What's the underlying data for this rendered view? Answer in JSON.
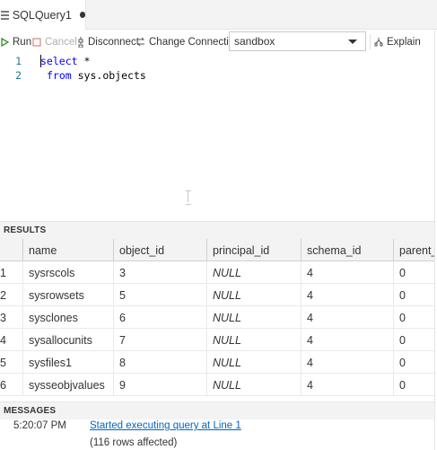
{
  "tab": {
    "title": "SQLQuery1",
    "icon": "file-lines-icon",
    "dirty_indicator": "dot"
  },
  "toolbar": {
    "run": "Run",
    "cancel": "Cancel",
    "disconnect": "Disconnect",
    "change_connection": "Change Connection",
    "database": "sandbox",
    "explain": "Explain"
  },
  "editor": {
    "lines": [
      {
        "number": "1",
        "keyword": "select",
        "rest": " *"
      },
      {
        "number": "2",
        "keyword": "from",
        "rest": " sys.objects"
      }
    ]
  },
  "results": {
    "header": "RESULTS",
    "columns": [
      "name",
      "object_id",
      "principal_id",
      "schema_id",
      "parent_"
    ],
    "rows": [
      {
        "num": "1",
        "cells": [
          "sysrscols",
          "3",
          "NULL",
          "4",
          "0"
        ]
      },
      {
        "num": "2",
        "cells": [
          "sysrowsets",
          "5",
          "NULL",
          "4",
          "0"
        ]
      },
      {
        "num": "3",
        "cells": [
          "sysclones",
          "6",
          "NULL",
          "4",
          "0"
        ]
      },
      {
        "num": "4",
        "cells": [
          "sysallocunits",
          "7",
          "NULL",
          "4",
          "0"
        ]
      },
      {
        "num": "5",
        "cells": [
          "sysfiles1",
          "8",
          "NULL",
          "4",
          "0"
        ]
      },
      {
        "num": "6",
        "cells": [
          "sysseobjvalues",
          "9",
          "NULL",
          "4",
          "0"
        ]
      }
    ]
  },
  "messages": {
    "header": "MESSAGES",
    "items": [
      {
        "time": "5:20:07 PM",
        "text": "Started executing query at Line 1",
        "link": true
      },
      {
        "time": "",
        "text": "(116 rows affected)",
        "link": false
      }
    ]
  },
  "colors": {
    "keyword": "#0000ff",
    "line_number": "#237893",
    "run_green": "#388a34",
    "link": "#0066bf"
  }
}
